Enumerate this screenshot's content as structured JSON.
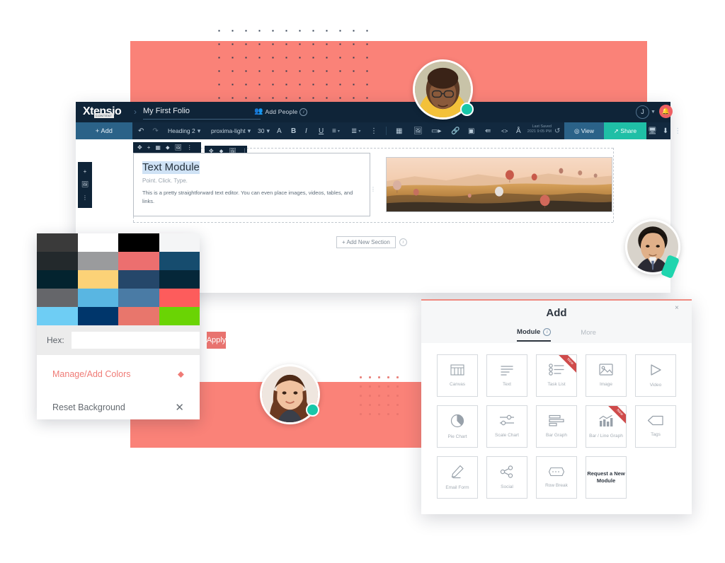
{
  "brand": {
    "accent_coral": "#fa8278",
    "accent_teal": "#1fbfa6",
    "dark_navy": "#0f2438",
    "toolbar_navy": "#12293f",
    "blue_button": "#2b6288"
  },
  "editor": {
    "logo_name": "Xtensio",
    "logo_tagline": "CONTENT",
    "breadcrumb_separator": "›",
    "document_title": "My First Folio",
    "add_people_label": "Add People",
    "add_people_icon": "add-person-icon",
    "info_icon": "i",
    "user_initial": "J",
    "bell_icon": "●",
    "toolbar": {
      "add_label": "+ Add",
      "undo_icon": "↶",
      "redo_icon": "↷",
      "paragraph_style": "Heading 2",
      "font_family": "proxima-light",
      "font_size": "30",
      "text_color_icon": "A",
      "bold_icon": "B",
      "italic_icon": "I",
      "underline_icon": "U",
      "align_icon": "≡",
      "list_icon": "≣",
      "more_icon": "⋮",
      "table_icon": "▦",
      "image_icon": "Ὓc",
      "video_icon": "▶",
      "link_icon": "⚭",
      "embed_icon": "▣",
      "share_node_icon": "⑂",
      "code_icon": "<>",
      "clear_format_icon": "A",
      "last_saved_line1": "Last Saved",
      "last_saved_line2": "2021 9:05 PM",
      "history_icon": "↺",
      "view_label": "View",
      "view_icon": "◉",
      "share_label": "Share",
      "share_icon": "↗",
      "present_icon": "⬜",
      "download_icon": "⤓",
      "overflow_icon": "⋮"
    },
    "module_handles": [
      "move-icon",
      "add-icon",
      "grid-icon",
      "droplet-icon",
      "image-icon",
      "more-icon"
    ],
    "module_handles_2": [
      "move-icon",
      "droplet-icon",
      "image-icon",
      "more-icon"
    ],
    "left_rail": [
      "add-icon",
      "image-icon",
      "more-icon"
    ],
    "text_module": {
      "heading": "Text Module",
      "subheading": "Point. Click. Type.",
      "body": "This is a pretty straightforward text editor. You can even place images, videos, tables, and links."
    },
    "photo_caption": "Hot air balloons over a valley at sunrise",
    "add_new_section_label": "+ Add New Section"
  },
  "color_panel": {
    "swatches": [
      "#3a3a3a",
      "#ffffff",
      "#000000",
      "#f4f5f6",
      "#23292c",
      "#9a9b9d",
      "#ec6f6f",
      "#164c6e",
      "#03232f",
      "#fcd277",
      "#25476a",
      "#052739",
      "#65666a",
      "#59b6e2",
      "#4a7ba5",
      "#fd5c5c",
      "#6ecdf4",
      "#00366b",
      "#e8766c",
      "#6ad404"
    ],
    "hex_label": "Hex:",
    "hex_value": "",
    "hex_placeholder": "",
    "apply_label": "Apply",
    "manage_label": "Manage/Add Colors",
    "manage_icon": "droplet-icon",
    "reset_label": "Reset Background",
    "reset_icon": "close-icon"
  },
  "add_modal": {
    "title": "Add",
    "close_icon": "×",
    "tabs": [
      {
        "label": "Module",
        "active": true,
        "info": true
      },
      {
        "label": "More",
        "active": false,
        "info": false
      }
    ],
    "modules": [
      {
        "name": "Canvas",
        "icon": "canvas-icon",
        "badge": ""
      },
      {
        "name": "Text",
        "icon": "text-lines-icon",
        "badge": ""
      },
      {
        "name": "Task List",
        "icon": "task-list-icon",
        "badge": "New"
      },
      {
        "name": "Image",
        "icon": "image-icon",
        "badge": ""
      },
      {
        "name": "Video",
        "icon": "play-triangle-icon",
        "badge": ""
      },
      {
        "name": "Pie Chart",
        "icon": "pie-chart-icon",
        "badge": ""
      },
      {
        "name": "Scale Chart",
        "icon": "sliders-icon",
        "badge": ""
      },
      {
        "name": "Bar Graph",
        "icon": "bar-graph-icon",
        "badge": ""
      },
      {
        "name": "Bar / Line Graph",
        "icon": "bar-line-graph-icon",
        "badge": "New"
      },
      {
        "name": "Tags",
        "icon": "tag-icon",
        "badge": ""
      },
      {
        "name": "Email Form",
        "icon": "pencil-icon",
        "badge": ""
      },
      {
        "name": "Social",
        "icon": "share-nodes-icon",
        "badge": ""
      },
      {
        "name": "Row Break",
        "icon": "row-break-icon",
        "badge": ""
      },
      {
        "name": "Request a New Module",
        "icon": "",
        "badge": ""
      }
    ]
  },
  "avatars": [
    {
      "name": "collaborator-1",
      "status": "online"
    },
    {
      "name": "collaborator-2",
      "status": "editing"
    },
    {
      "name": "collaborator-3",
      "status": "online"
    }
  ]
}
